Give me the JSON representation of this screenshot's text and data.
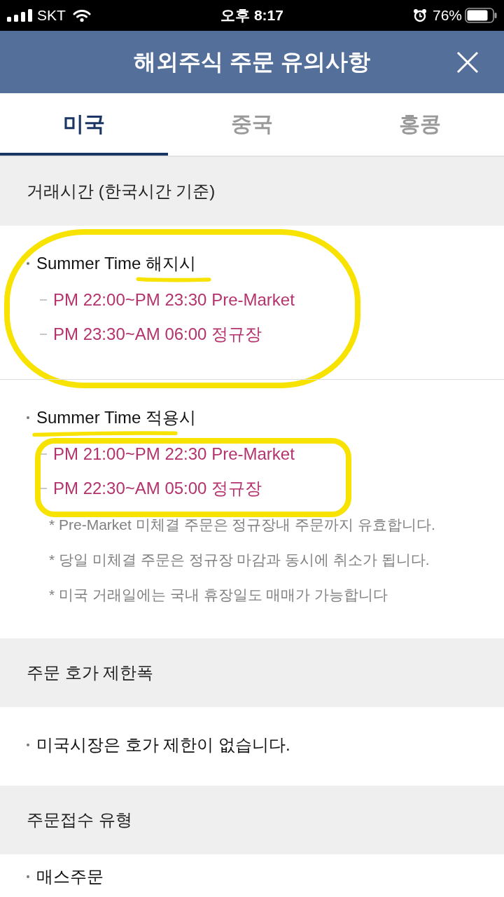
{
  "status_bar": {
    "carrier": "SKT",
    "time": "오후 8:17",
    "battery": "76%"
  },
  "header": {
    "title": "해외주식 주문 유의사항"
  },
  "tabs": [
    {
      "label": "미국",
      "selected": true
    },
    {
      "label": "중국",
      "selected": false
    },
    {
      "label": "홍콩",
      "selected": false
    }
  ],
  "sections": [
    {
      "title": "거래시간 (한국시간 기준)",
      "groups": [
        {
          "heading": "Summer Time 해지시",
          "marker": {
            "kind": "ellipse"
          },
          "underline": {
            "kind": "partial"
          },
          "times": [
            "PM 22:00~PM 23:30 Pre-Market",
            "PM 23:30~AM 06:00 정규장"
          ]
        },
        {
          "heading": "Summer Time 적용시",
          "marker": {
            "kind": "box"
          },
          "underline": {
            "kind": "full"
          },
          "times": [
            "PM 21:00~PM 22:30 Pre-Market",
            "PM 22:30~AM 05:00 정규장"
          ],
          "notes": [
            "* Pre-Market 미체결 주문은 정규장내 주문까지 유효합니다.",
            "* 당일 미체결 주문은 정규장 마감과 동시에 취소가 됩니다.",
            "* 미국 거래일에는 국내 휴장일도 매매가 가능합니다"
          ]
        }
      ]
    },
    {
      "title": "주문 호가 제한폭",
      "groups": [
        {
          "heading": "미국시장은 호가 제한이 없습니다."
        }
      ]
    },
    {
      "title": "주문접수 유형",
      "groups": [
        {
          "heading": "매스주문"
        }
      ]
    }
  ]
}
